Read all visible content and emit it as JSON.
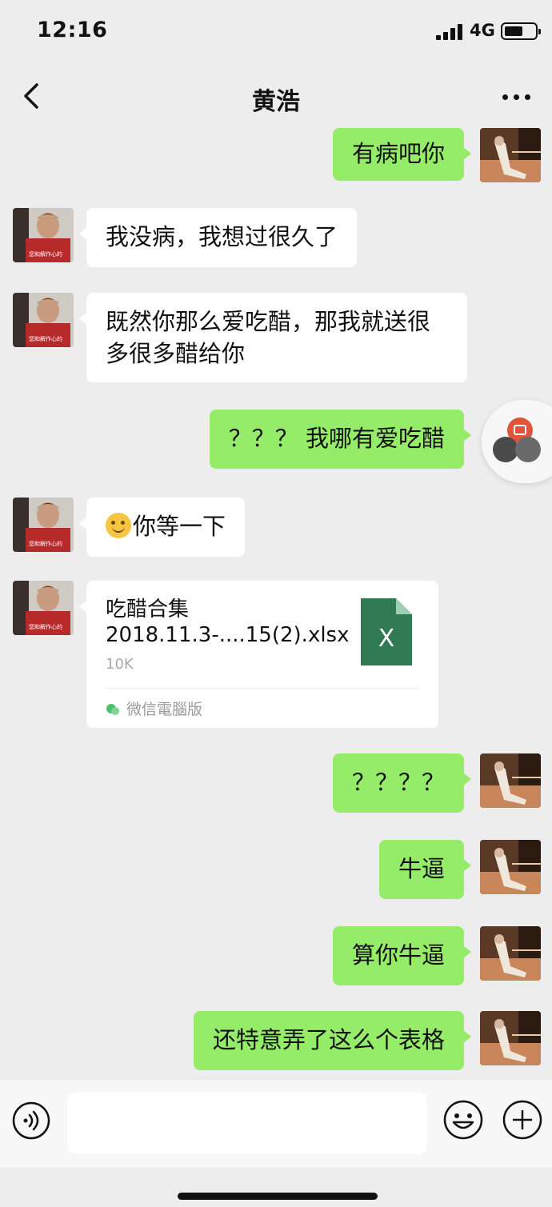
{
  "status_bar": {
    "time": "12:16",
    "network": "4G"
  },
  "nav": {
    "title": "黄浩"
  },
  "messages": [
    {
      "side": "right",
      "text": "有病吧你"
    },
    {
      "side": "left",
      "text": "我没病，我想过很久了"
    },
    {
      "side": "left",
      "text": "既然你那么爱吃醋，那我就送很多很多醋给你"
    },
    {
      "side": "right",
      "text": "？？？ 我哪有爱吃醋"
    },
    {
      "side": "left",
      "text": "你等一下"
    },
    {
      "side": "left",
      "type": "file",
      "file_name": "吃醋合集 2018.11.3-....15(2).xlsx",
      "file_size": "10K",
      "source": "微信電腦版",
      "icon_letter": "X"
    },
    {
      "side": "right",
      "text": "？？？？"
    },
    {
      "side": "right",
      "text": "牛逼"
    },
    {
      "side": "right",
      "text": "算你牛逼"
    },
    {
      "side": "right",
      "text": "还特意弄了这么个表格"
    }
  ],
  "input": {
    "placeholder": ""
  },
  "colors": {
    "background": "#ededed",
    "my_bubble": "#95ec69",
    "their_bubble": "#ffffff",
    "excel_icon": "#2f7a52"
  },
  "icons": [
    "back-icon",
    "more-icon",
    "voice-icon",
    "emoji-icon",
    "add-icon",
    "excel-file-icon",
    "wechat-pc-icon"
  ]
}
